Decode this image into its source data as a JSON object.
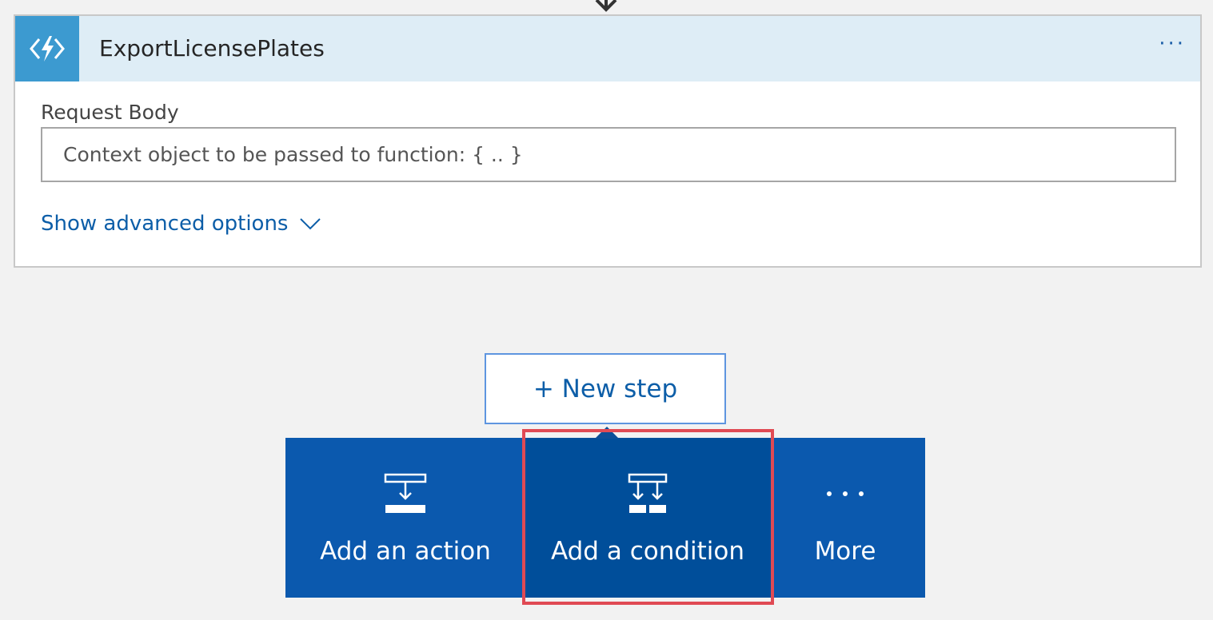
{
  "action_card": {
    "icon": "azure-function-icon",
    "title": "ExportLicensePlates",
    "menu_icon": "ellipsis-icon",
    "request_body": {
      "label": "Request Body",
      "value": "",
      "placeholder": "Context object to be passed to function: { .. }"
    },
    "advanced_options_label": "Show advanced options",
    "advanced_options_icon": "chevron-down-icon"
  },
  "new_step": {
    "label": "+ New step"
  },
  "step_options": [
    {
      "label": "Add an action",
      "icon": "add-action-icon"
    },
    {
      "label": "Add a condition",
      "icon": "add-condition-icon",
      "highlighted": true
    },
    {
      "label": "More",
      "icon": "ellipsis-icon"
    }
  ],
  "colors": {
    "header_bg": "#deedf6",
    "icon_bg": "#3c9ad0",
    "link": "#0d5ea8",
    "menu_bg": "#0b59ae",
    "menu_selected_bg": "#004e9a",
    "highlight_border": "#e04a54"
  }
}
